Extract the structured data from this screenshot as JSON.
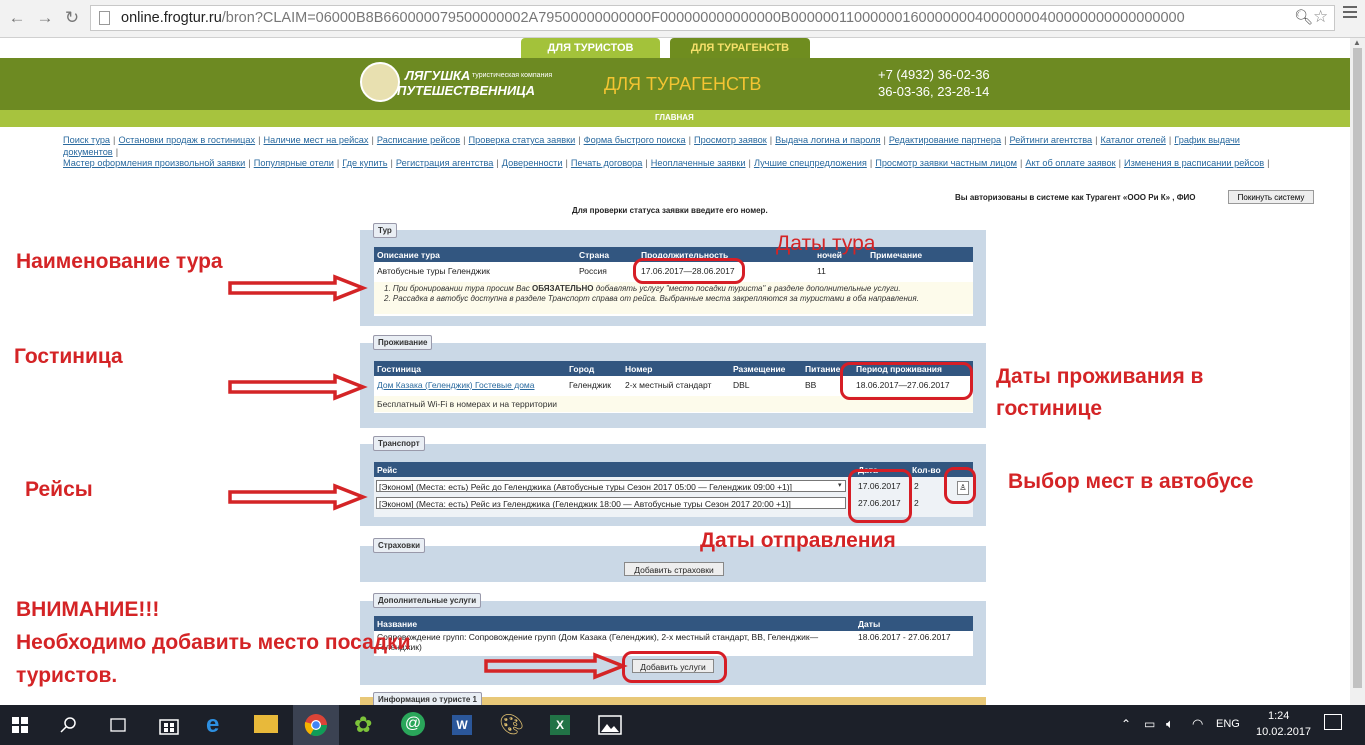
{
  "browser": {
    "url_host": "online.frogtur.ru",
    "url_path": "/bron?CLAIM=06000B8B660000079500000002A79500000000000F000000000000000B0000001100000016000000040000000400000000000000000"
  },
  "site": {
    "tab_tourists": "ДЛЯ ТУРИСТОВ",
    "tab_agencies": "ДЛЯ ТУРАГЕНСТВ",
    "logo_line1": "ЛЯГУШКА",
    "logo_line2": "ПУТЕШЕСТВЕННИЦА",
    "logo_sub": "туристическая компания",
    "title": "ДЛЯ ТУРАГЕНСТВ",
    "phone1": "+7 (4932) 36-02-36",
    "phone2": "36-03-36, 23-28-14",
    "subnav": "ГЛАВНАЯ"
  },
  "links": [
    "Поиск тура",
    "Остановки продаж в гостиницах",
    "Наличие мест на рейсах",
    "Расписание рейсов",
    "Проверка статуса заявки",
    "Форма быстрого поиска",
    "Просмотр заявок",
    "Выдача логина и пароля",
    "Редактирование партнера",
    "Рейтинги агентства",
    "Каталог отелей",
    "График выдачи документов",
    "Мастер оформления произвольной заявки",
    "Популярные отели",
    "Где купить",
    "Регистрация агентства",
    "Доверенности",
    "Печать договора",
    "Неоплаченные заявки",
    "Лучшие спецпредложения",
    "Просмотр заявки частным лицом",
    "Акт об оплате заявок",
    "Изменения в расписании рейсов"
  ],
  "auth": {
    "text": "Вы авторизованы в системе как Турагент «ООО Ри К» , ФИО",
    "logout": "Покинуть систему",
    "check_note": "Для проверки статуса заявки введите его номер."
  },
  "tour": {
    "legend": "Тур",
    "headers": [
      "Описание тура",
      "Страна",
      "Продолжительность",
      "ночей",
      "Примечание"
    ],
    "row": [
      "Автобусные туры Геленджик",
      "Россия",
      "17.06.2017—28.06.2017",
      "11",
      ""
    ],
    "note1_a": "При бронировании тура просим Вас",
    "note1_b": "ОБЯЗАТЕЛЬНО",
    "note1_c": "добавлять услугу \"место посадки туриста\" в разделе дополнительные услуги.",
    "note2": "Рассадка в автобус доступна в разделе Транспорт справа от рейса. Выбранные места закрепляются за туристами в оба направления."
  },
  "lodging": {
    "legend": "Проживание",
    "headers": [
      "Гостиница",
      "Город",
      "Номер",
      "Размещение",
      "Питание",
      "Период проживания"
    ],
    "row": [
      "Дом Казака (Геленджик) Гостевые дома",
      "Геленджик",
      "2-х местный стандарт",
      "DBL",
      "BB",
      "18.06.2017—27.06.2017"
    ],
    "note": "Бесплатный Wi-Fi в номерах и на территории"
  },
  "transport": {
    "legend": "Транспорт",
    "headers": [
      "Рейс",
      "Дата",
      "Кол-во"
    ],
    "rows": [
      {
        "route": "[Эконом] (Места: есть) Рейс до Геленджика (Автобусные туры Сезон 2017 05:00 — Геленджик 09:00 +1)]",
        "date": "17.06.2017",
        "qty": "2"
      },
      {
        "route": "[Эконом] (Места: есть) Рейс из Геленджика (Геленджик 18:00 — Автобусные туры Сезон 2017 20:00 +1)]",
        "date": "27.06.2017",
        "qty": "2"
      }
    ]
  },
  "insurance": {
    "legend": "Страховки",
    "add_button": "Добавить страховки"
  },
  "extra": {
    "legend": "Дополнительные услуги",
    "headers": [
      "Название",
      "Даты"
    ],
    "row_name": "Сопровождение групп: Сопровождение групп (Дом Казака (Геленджик), 2-х местный стандарт, BB, Геленджик— Геленджик)",
    "row_dates": "18.06.2017 - 27.06.2017",
    "add_button": "Добавить услуги"
  },
  "tourist_info": {
    "legend": "Информация о туристе 1"
  },
  "annotations": {
    "tour_name": "Наименование тура",
    "tour_dates": "Даты тура",
    "hotel": "Гостиница",
    "hotel_dates_1": "Даты проживания в",
    "hotel_dates_2": "гостинице",
    "flights": "Рейсы",
    "bus_seats": "Выбор мест в автобусе",
    "departure_dates": "Даты отправления",
    "warning_1": "ВНИМАНИЕ!!!",
    "warning_2": "Необходимо добавить место посадки",
    "warning_3": "туристов."
  },
  "colors": {
    "accent_red": "#d42426",
    "header_green": "#6d8a22",
    "table_header_blue": "#325680"
  },
  "taskbar": {
    "lang": "ENG",
    "time": "1:24",
    "date": "10.02.2017"
  }
}
